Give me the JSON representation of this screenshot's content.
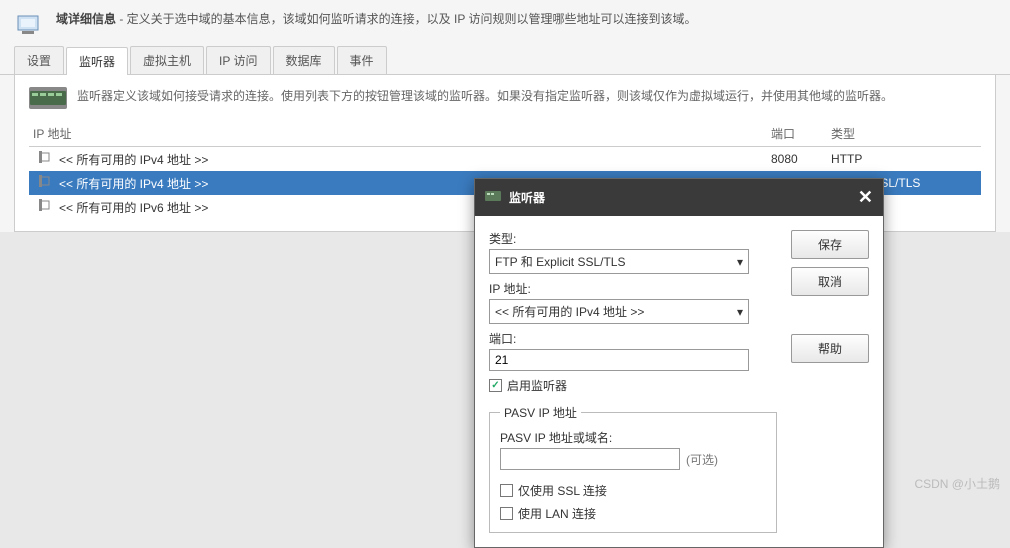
{
  "header": {
    "title_prefix": "域详细信息",
    "title_desc": " - 定义关于选中域的基本信息，该域如何监听请求的连接，以及 IP 访问规则以管理哪些地址可以连接到该域。"
  },
  "tabs": {
    "items": [
      "设置",
      "监听器",
      "虚拟主机",
      "IP 访问",
      "数据库",
      "事件"
    ],
    "active_index": 1
  },
  "info": {
    "text": "监听器定义该域如何接受请求的连接。使用列表下方的按钮管理该域的监听器。如果没有指定监听器，则该域仅作为虚拟域运行，并使用其他域的监听器。"
  },
  "table": {
    "headers": {
      "ip": "IP 地址",
      "port": "端口",
      "type": "类型"
    },
    "rows": [
      {
        "ip": "<< 所有可用的 IPv4 地址 >>",
        "port": "8080",
        "type": "HTTP",
        "selected": false
      },
      {
        "ip": "<< 所有可用的 IPv4 地址 >>",
        "port": "",
        "type": "Explicit SSL/TLS",
        "selected": true
      },
      {
        "ip": "<< 所有可用的 IPv6 地址 >>",
        "port": "",
        "type": "",
        "selected": false
      }
    ]
  },
  "dialog": {
    "title": "监听器",
    "buttons": {
      "save": "保存",
      "cancel": "取消",
      "help": "帮助"
    },
    "form": {
      "type_label": "类型:",
      "type_value": "FTP 和 Explicit SSL/TLS",
      "ip_label": "IP 地址:",
      "ip_value": "<< 所有可用的 IPv4 地址 >>",
      "port_label": "端口:",
      "port_value": "21",
      "enable_label": "启用监听器",
      "enable_checked": true,
      "fieldset_label": "PASV IP 地址",
      "pasv_label": "PASV IP 地址或域名:",
      "pasv_value": "",
      "optional": "(可选)",
      "ssl_only_label": "仅使用 SSL 连接",
      "ssl_only_checked": false,
      "lan_label": "使用 LAN 连接",
      "lan_checked": false
    }
  },
  "watermark": "CSDN @小土鹅"
}
